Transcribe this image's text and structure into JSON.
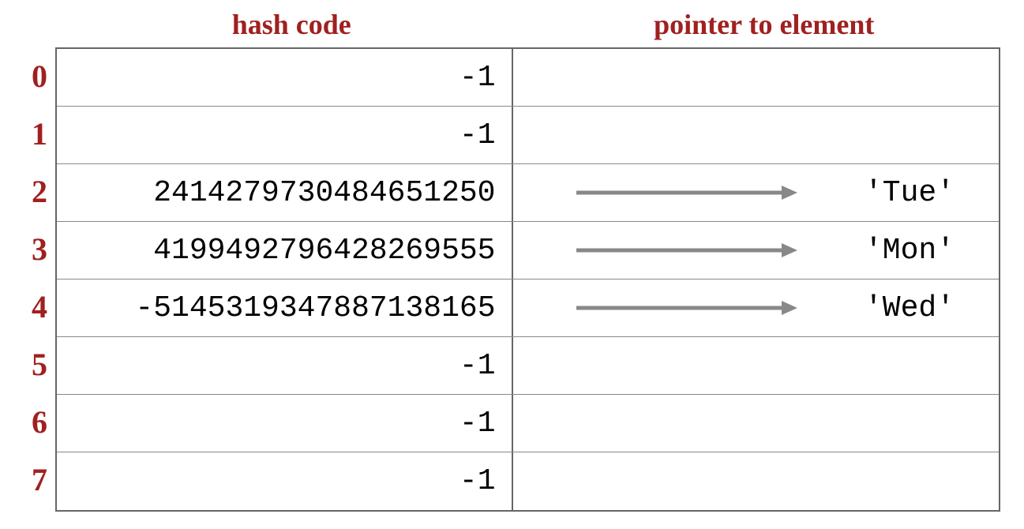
{
  "headers": {
    "hash_code": "hash code",
    "pointer": "pointer to element"
  },
  "rows": [
    {
      "index": "0",
      "hash": "-1",
      "element": null
    },
    {
      "index": "1",
      "hash": "-1",
      "element": null
    },
    {
      "index": "2",
      "hash": "2414279730484651250",
      "element": "'Tue'"
    },
    {
      "index": "3",
      "hash": "4199492796428269555",
      "element": "'Mon'"
    },
    {
      "index": "4",
      "hash": "-5145319347887138165",
      "element": "'Wed'"
    },
    {
      "index": "5",
      "hash": "-1",
      "element": null
    },
    {
      "index": "6",
      "hash": "-1",
      "element": null
    },
    {
      "index": "7",
      "hash": "-1",
      "element": null
    }
  ]
}
